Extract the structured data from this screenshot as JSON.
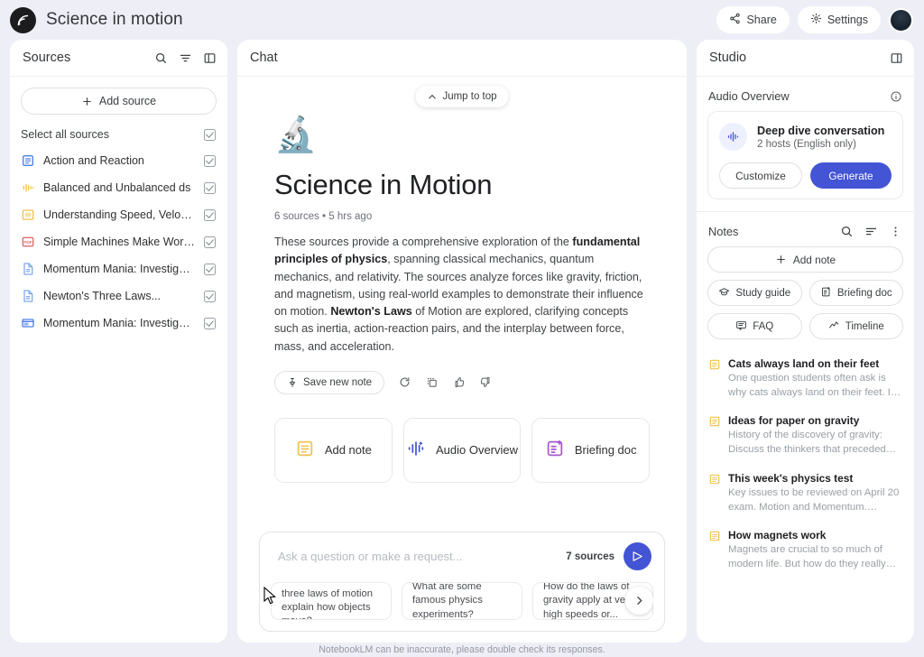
{
  "header": {
    "logo_icon": "notebooklm-logo-icon",
    "title": "Science in motion",
    "share_label": "Share",
    "settings_label": "Settings"
  },
  "sources": {
    "panel_title": "Sources",
    "search_icon": "search-icon",
    "filter_icon": "filter-icon",
    "collapse_icon": "panel-toggle-icon",
    "add_source_label": "Add source",
    "select_all_label": "Select all sources",
    "items": [
      {
        "name": "Action and Reaction",
        "icon": "google-docs-icon",
        "color": "#4d7fe8",
        "checked": true
      },
      {
        "name": "Balanced and Unbalanced ds",
        "icon": "audio-waveform-icon",
        "color": "#f2c14b",
        "checked": true
      },
      {
        "name": "Understanding Speed, Velocity and...",
        "icon": "google-slides-icon",
        "color": "#f2c14b",
        "checked": true
      },
      {
        "name": "Simple Machines Make Work Easier...",
        "icon": "pdf-icon",
        "color": "#e06c6c",
        "checked": true
      },
      {
        "name": "Momentum Mania: Investigating th...",
        "icon": "document-icon",
        "color": "#7fa9ef",
        "checked": true
      },
      {
        "name": "Newton's Three Laws...",
        "icon": "document-icon",
        "color": "#7fa9ef",
        "checked": true
      },
      {
        "name": "Momentum Mania: Investigating th...",
        "icon": "slides-icon",
        "color": "#4d7fe8",
        "checked": true
      }
    ]
  },
  "chat": {
    "panel_title": "Chat",
    "jump_to_top_label": "Jump to top",
    "jump_icon": "chevron-up-icon",
    "doc_emoji": "🔬",
    "doc_title": "Science in Motion",
    "doc_meta": "6 sources • 5 hrs ago",
    "summary_parts": [
      {
        "text": "These sources provide a comprehensive exploration of the ",
        "bold": false
      },
      {
        "text": "fundamental principles of physics",
        "bold": true
      },
      {
        "text": ", spanning classical mechanics, quantum mechanics, and relativity. The sources analyze forces like gravity, friction, and magnetism, using real-world examples to demonstrate their influence on motion. ",
        "bold": false
      },
      {
        "text": "Newton's Laws",
        "bold": true
      },
      {
        "text": " of Motion are explored, clarifying concepts such as inertia, action-reaction pairs, and the interplay between force, mass, and acceleration.",
        "bold": false
      }
    ],
    "save_note_label": "Save new note",
    "save_note_icon": "pin-icon",
    "action_icons": [
      "refresh-icon",
      "copy-icon",
      "thumbs-up-icon",
      "thumbs-down-icon"
    ],
    "cards": [
      {
        "label": "Add note",
        "icon": "note-icon",
        "color": "#f2c14b"
      },
      {
        "label": "Audio Overview",
        "icon": "audio-waveform-icon",
        "color": "#4355d4"
      },
      {
        "label": "Briefing doc",
        "icon": "briefing-doc-icon",
        "color": "#a855d4"
      }
    ],
    "composer": {
      "placeholder": "Ask a question or make a request...",
      "value": "",
      "sources_count_label": "7 sources",
      "send_icon": "send-icon",
      "next_icon": "chevron-right-icon",
      "suggestions": [
        "How do Newton's three laws of motion explain how objects move?",
        "What are some famous physics experiments?",
        "How do the laws of gravity apply at very high speeds or..."
      ]
    }
  },
  "studio": {
    "panel_title": "Studio",
    "collapse_icon": "panel-toggle-icon",
    "audio_overview": {
      "section_title": "Audio Overview",
      "info_icon": "info-icon",
      "card_icon": "audio-waveform-icon",
      "card_title": "Deep dive conversation",
      "card_subtitle": "2 hosts (English only)",
      "customize_label": "Customize",
      "generate_label": "Generate"
    },
    "notes": {
      "section_title": "Notes",
      "search_icon": "search-icon",
      "sort_icon": "sort-icon",
      "more_icon": "more-vertical-icon",
      "add_note_label": "Add note",
      "chips": [
        {
          "label": "Study guide",
          "icon": "graduation-cap-icon"
        },
        {
          "label": "Briefing doc",
          "icon": "briefing-doc-icon"
        },
        {
          "label": "FAQ",
          "icon": "faq-icon"
        },
        {
          "label": "Timeline",
          "icon": "timeline-icon"
        }
      ],
      "items": [
        {
          "title": "Cats always land on their feet",
          "preview": "One question students often ask is why cats always land on their feet. It's a fasci…"
        },
        {
          "title": "Ideas for paper on gravity",
          "preview": "History of the discovery of gravity: Discuss the thinkers that preceded Newt…"
        },
        {
          "title": "This week's physics test",
          "preview": "Key issues to be reviewed on April 20 exam. Motion and Momentum. Conserva…"
        },
        {
          "title": "How magnets work",
          "preview": "Magnets are crucial to so much of modern life. But how do they really work…"
        }
      ]
    }
  },
  "footer": {
    "disclaimer": "NotebookLM can be inaccurate, please double check its responses."
  }
}
